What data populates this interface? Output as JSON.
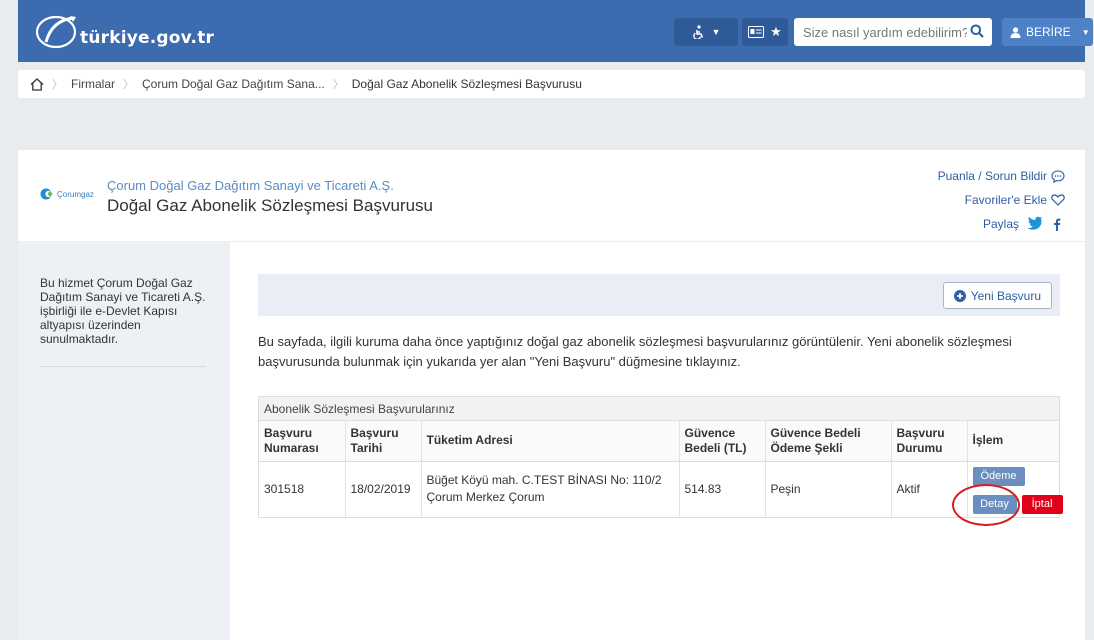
{
  "topbar": {
    "logo_text": "türkiye.gov.tr",
    "logo_subtext": "",
    "accessibility_icon": "accessibility-icon",
    "search_placeholder": "Size nasıl yardım edebilirim?",
    "user_name": "BERİRE"
  },
  "breadcrumb": {
    "items": [
      "Firmalar",
      "Çorum Doğal Gaz Dağıtım Sana...",
      "Doğal Gaz Abonelik Sözleşmesi Başvurusu"
    ]
  },
  "header": {
    "company_logo_text": "Çorumgaz",
    "company_name": "Çorum Doğal Gaz Dağıtım Sanayi ve Ticareti A.Ş.",
    "service_title": "Doğal Gaz Abonelik Sözleşmesi Başvurusu",
    "rate_label": "Puanla / Sorun Bildir",
    "favorite_label": "Favoriler'e Ekle",
    "share_label": "Paylaş"
  },
  "sidebar": {
    "info": "Bu hizmet Çorum Doğal Gaz Dağıtım Sanayi ve Ticareti A.Ş. işbirliği ile e-Devlet Kapısı altyapısı üzerinden sunulmaktadır."
  },
  "main": {
    "new_button_label": "Yeni Başvuru",
    "info_text": "Bu sayfada, ilgili kuruma daha önce yaptığınız doğal gaz abonelik sözleşmesi başvurularınız görüntülenir. Yeni abonelik sözleşmesi başvurusunda bulunmak için yukarıda yer alan \"Yeni Başvuru\" düğmesine tıklayınız.",
    "table": {
      "caption": "Abonelik Sözleşmesi Başvurularınız",
      "headers": [
        "Başvuru Numarası",
        "Başvuru Tarihi",
        "Tüketim Adresi",
        "Güvence Bedeli (TL)",
        "Güvence Bedeli Ödeme Şekli",
        "Başvuru Durumu",
        "İşlem"
      ],
      "rows": [
        {
          "number": "301518",
          "date": "18/02/2019",
          "address": "Büğet Köyü mah. C.TEST BİNASI No: 110/2 Çorum Merkez Çorum",
          "deposit": "514.83",
          "payment_method": "Peşin",
          "status": "Aktif",
          "pay_label": "Ödeme",
          "detail_label": "Detay",
          "cancel_label": "İptal"
        }
      ]
    }
  },
  "colors": {
    "topbar": "#3d6bb0",
    "accent": "#2d5fa3",
    "cancel": "#e0001a"
  }
}
